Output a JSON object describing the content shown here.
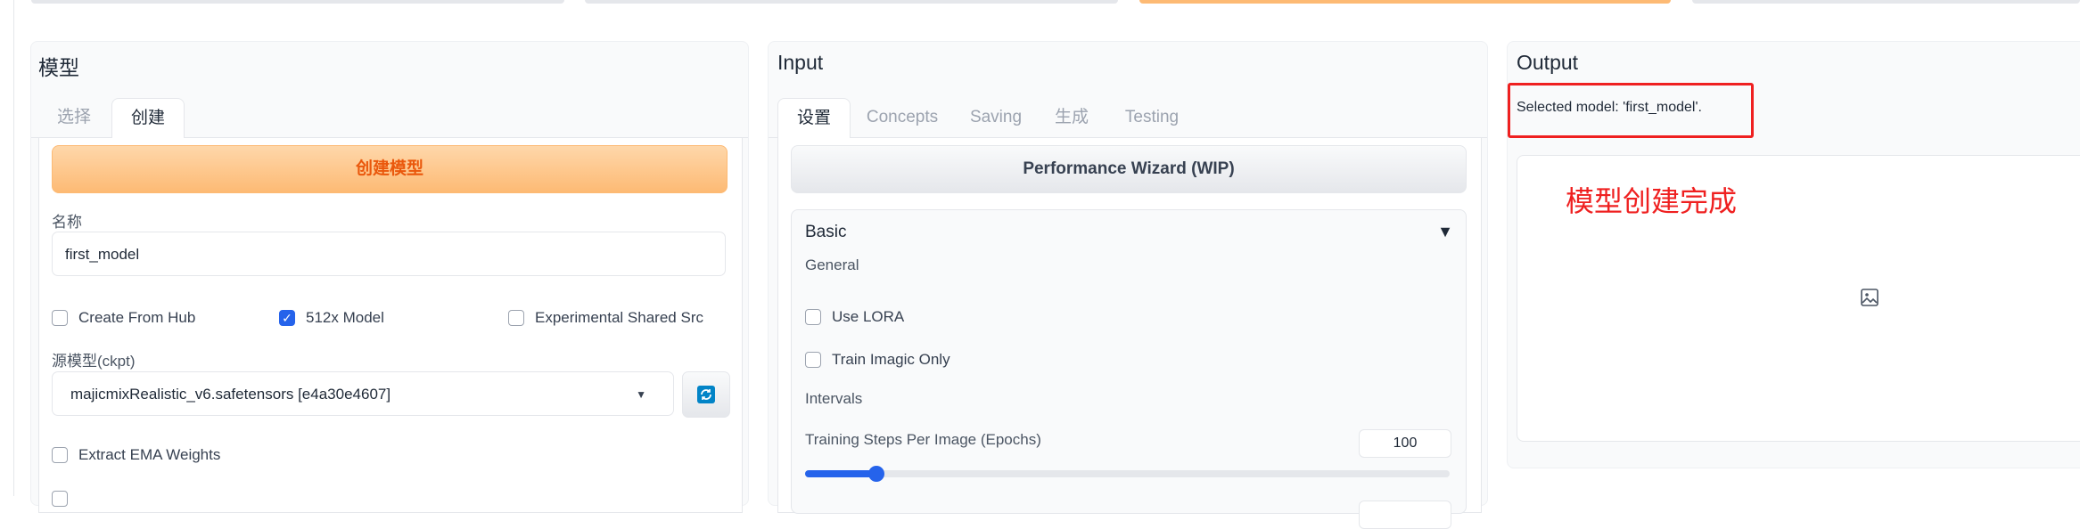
{
  "model_panel": {
    "title": "模型",
    "tabs": [
      "选择",
      "创建"
    ],
    "create_button": "创建模型",
    "name_label": "名称",
    "name_value": "first_model",
    "checkboxes": [
      {
        "label": "Create From Hub",
        "checked": false
      },
      {
        "label": "512x Model",
        "checked": true
      },
      {
        "label": "Experimental Shared Src",
        "checked": false
      }
    ],
    "source_label": "源模型(ckpt)",
    "source_value": "majicmixRealistic_v6.safetensors [e4a30e4607]",
    "extract_ema_label": "Extract EMA Weights"
  },
  "input_panel": {
    "title": "Input",
    "tabs": [
      "设置",
      "Concepts",
      "Saving",
      "生成",
      "Testing"
    ],
    "wizard_button": "Performance Wizard (WIP)",
    "basic": {
      "title": "Basic",
      "collapse_glyph": "▼",
      "general_label": "General",
      "use_lora_label": "Use LORA",
      "train_imagic_label": "Train Imagic Only",
      "intervals_label": "Intervals",
      "epochs_label": "Training Steps Per Image (Epochs)",
      "epochs_value": "100",
      "epochs_fraction": 0.11
    }
  },
  "output_panel": {
    "title": "Output",
    "status_text": "Selected model: 'first_model'.",
    "annotation_text": "模型创建完成",
    "image_icon": "image-placeholder-icon"
  },
  "colors": {
    "accent_orange": "#fdba74",
    "accent_blue": "#2563eb",
    "annotation_red": "#ef2020"
  }
}
